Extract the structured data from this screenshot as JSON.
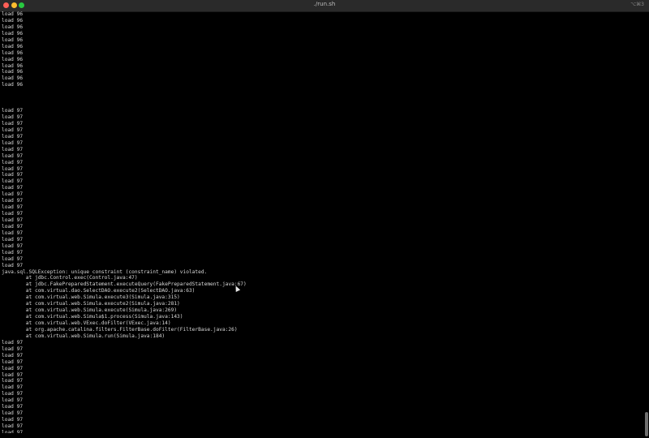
{
  "window": {
    "title": "./run.sh",
    "shortcut": "⌥⌘3"
  },
  "terminal": {
    "lines": [
      "load 96",
      "load 96",
      "load 96",
      "load 96",
      "load 96",
      "load 96",
      "load 96",
      "load 96",
      "load 96",
      "load 96",
      "load 96",
      "load 96",
      "",
      "",
      "",
      "load 97",
      "load 97",
      "load 97",
      "load 97",
      "load 97",
      "load 97",
      "load 97",
      "load 97",
      "load 97",
      "load 97",
      "load 97",
      "load 97",
      "load 97",
      "load 97",
      "load 97",
      "load 97",
      "load 97",
      "load 97",
      "load 97",
      "load 97",
      "load 97",
      "load 97",
      "load 97",
      "load 97",
      "load 97",
      "java.sql.SQLException: unique constraint (constraint_name) violated.",
      "        at jdbc.Control.exec(Control.java:47)",
      "        at jdbc.FakePreparedStatement.executeQuery(FakePreparedStatement.java:67)",
      "        at com.virtual.dao.SelectDAO.execute2(SelectDAO.java:63)",
      "        at com.virtual.web.Simula.execute3(Simula.java:315)",
      "        at com.virtual.web.Simula.execute2(Simula.java:281)",
      "        at com.virtual.web.Simula.execute(Simula.java:269)",
      "        at com.virtual.web.Simula$1.process(Simula.java:143)",
      "        at com.virtual.web.VExec.doFilter(VExec.java:14)",
      "        at org.apache.catalina.filters.FilterBase.doFilter(FilterBase.java:26)",
      "        at com.virtual.web.Simula.run(Simula.java:184)",
      "load 97",
      "load 97",
      "load 97",
      "load 97",
      "load 97",
      "load 97",
      "load 97",
      "load 97",
      "load 97",
      "load 97",
      "load 97",
      "load 97",
      "load 97",
      "load 97",
      "load 97"
    ]
  },
  "colors": {
    "background": "#000000",
    "text": "#d8d8d8",
    "titlebar": "#2a2a2a",
    "close": "#ff5f57",
    "minimize": "#febc2e",
    "maximize": "#28c840"
  },
  "icons": {
    "close": "close-icon",
    "minimize": "minimize-icon",
    "maximize": "maximize-icon"
  }
}
